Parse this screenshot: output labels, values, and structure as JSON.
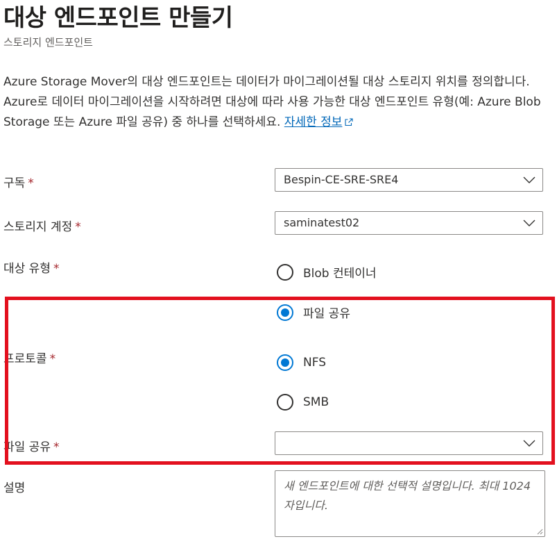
{
  "header": {
    "title": "대상 엔드포인트 만들기",
    "subtitle": "스토리지 엔드포인트"
  },
  "description": {
    "text": "Azure Storage Mover의 대상 엔드포인트는 데이터가 마이그레이션될 대상 스토리지 위치를 정의합니다. Azure로 데이터 마이그레이션을 시작하려면 대상에 따라 사용 가능한 대상 엔드포인트 유형(예: Azure Blob Storage 또는 Azure 파일 공유) 중 하나를 선택하세요.",
    "link_label": "자세한 정보"
  },
  "form": {
    "subscription": {
      "label": "구독",
      "value": "Bespin-CE-SRE-SRE4"
    },
    "storage_account": {
      "label": "스토리지 계정",
      "value": "saminatest02"
    },
    "target_type": {
      "label": "대상 유형",
      "options": [
        "Blob 컨테이너",
        "파일 공유"
      ],
      "selected": "파일 공유"
    },
    "protocol": {
      "label": "프로토콜",
      "options": [
        "NFS",
        "SMB"
      ],
      "selected": "NFS"
    },
    "file_share": {
      "label": "파일 공유",
      "value": ""
    },
    "description_field": {
      "label": "설명",
      "placeholder": "새 엔드포인트에 대한 선택적 설명입니다. 최대 1024자입니다."
    },
    "required_marker": "*"
  },
  "colors": {
    "accent": "#0078d4",
    "link": "#0067b8",
    "required": "#a4262c",
    "highlight_border": "#e3101e"
  }
}
